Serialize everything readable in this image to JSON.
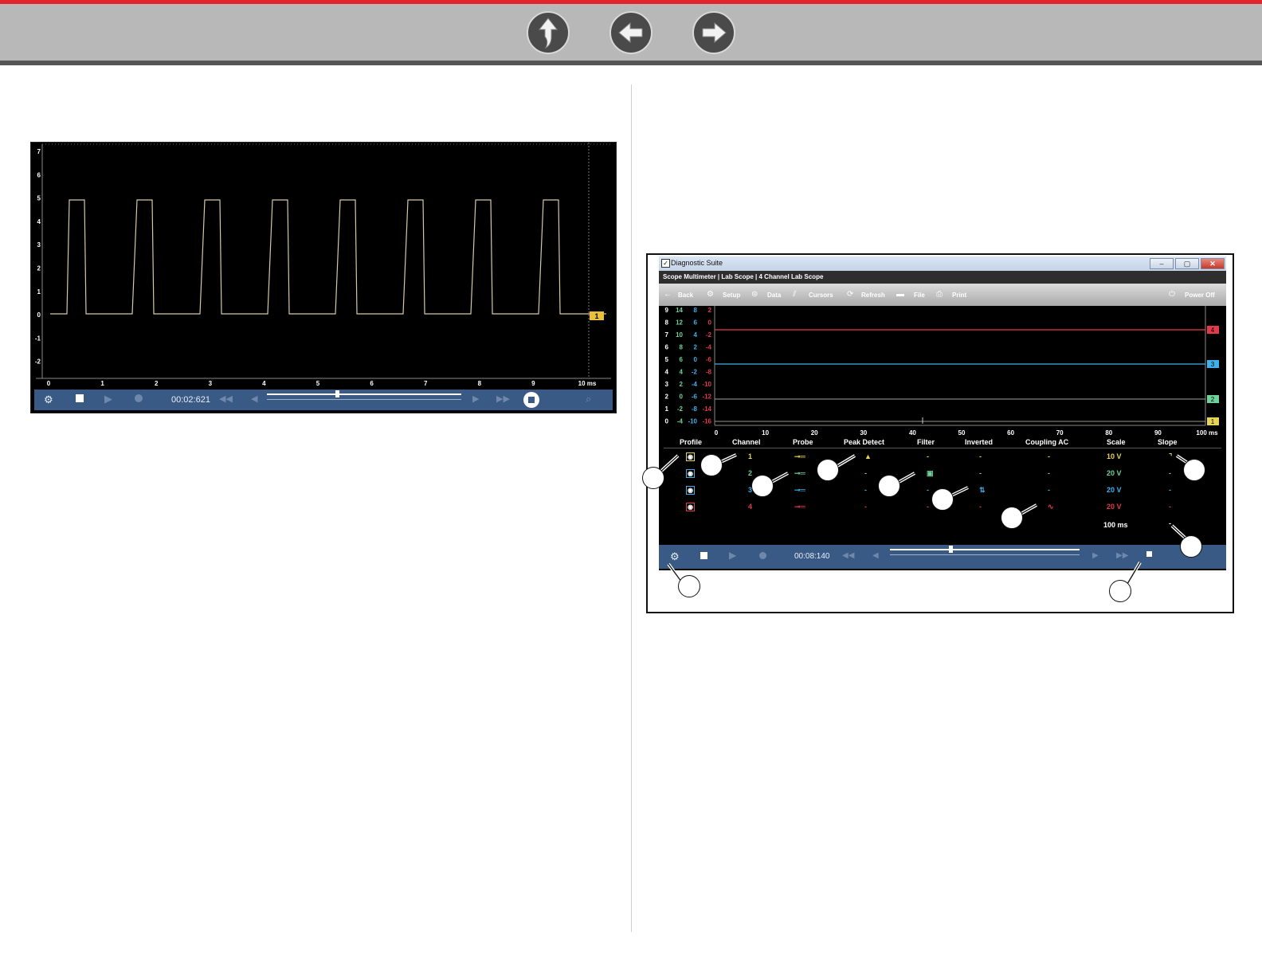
{
  "nav": {
    "up": "up-arrow-icon",
    "back": "left-arrow-icon",
    "forward": "right-arrow-icon"
  },
  "left_scope": {
    "y_ticks": [
      "7",
      "6",
      "5",
      "4",
      "3",
      "2",
      "1",
      "0",
      "-1",
      "-2"
    ],
    "x_ticks": [
      "0",
      "1",
      "2",
      "3",
      "4",
      "5",
      "6",
      "7",
      "8",
      "9",
      "10 ms"
    ],
    "channel_marker": "1",
    "timer": "00:02:621"
  },
  "right_screen": {
    "window_title": "Diagnostic Suite",
    "breadcrumb": "Scope Multimeter | Lab Scope | 4 Channel Lab Scope",
    "toolbar": {
      "back": "Back",
      "setup": "Setup",
      "data": "Data",
      "cursors": "Cursors",
      "refresh": "Refresh",
      "file": "File",
      "print": "Print",
      "power_off": "Power Off"
    },
    "scale_col1": [
      "9",
      "8",
      "7",
      "6",
      "5",
      "4",
      "3",
      "2",
      "1",
      "0"
    ],
    "scale_col2": [
      "14",
      "12",
      "10",
      "8",
      "6",
      "4",
      "2",
      "0",
      "-2",
      "-4"
    ],
    "scale_col3": [
      "8",
      "6",
      "4",
      "2",
      "0",
      "-2",
      "-4",
      "-6",
      "-8",
      "-10"
    ],
    "scale_col4": [
      "2",
      "0",
      "-2",
      "-4",
      "-6",
      "-8",
      "-10",
      "-12",
      "-14",
      "-16"
    ],
    "x_ticks": [
      "0",
      "10",
      "20",
      "30",
      "40",
      "50",
      "60",
      "70",
      "80",
      "90",
      "100 ms"
    ],
    "channel_markers": [
      "4",
      "3",
      "2",
      "1"
    ],
    "headers": [
      "Profile",
      "Channel",
      "Probe",
      "Peak Detect",
      "Filter",
      "Inverted",
      "Coupling AC",
      "Scale",
      "Slope"
    ],
    "rows": [
      {
        "channel": "1",
        "peak": "▲",
        "filter": "-",
        "inverted": "-",
        "coupling": "-",
        "scale": "10 V",
        "slope": "⌝"
      },
      {
        "channel": "2",
        "peak": "-",
        "filter": "▣",
        "inverted": "-",
        "coupling": "-",
        "scale": "20 V",
        "slope": "-"
      },
      {
        "channel": "3",
        "peak": "-",
        "filter": "-",
        "inverted": "⇅",
        "coupling": "-",
        "scale": "20 V",
        "slope": "-"
      },
      {
        "channel": "4",
        "peak": "-",
        "filter": "-",
        "inverted": "-",
        "coupling": "∿",
        "scale": "20 V",
        "slope": "-"
      }
    ],
    "timebase": "100 ms",
    "timebase_slope": "-",
    "timer": "00:08:140"
  },
  "colors": {
    "ch1": "#e8d35a",
    "ch2": "#6ed39a",
    "ch3": "#3fb0e8",
    "ch4": "#e23a4a",
    "toolbar_blue": "#3a5a86"
  }
}
